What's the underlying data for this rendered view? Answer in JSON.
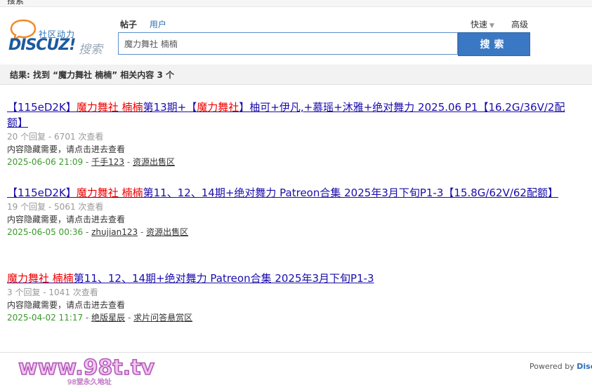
{
  "topbar": {
    "text": "搜索"
  },
  "logo": {
    "cn_text": "社区动力",
    "en_text": "DISCUZ!",
    "search_text": "搜索"
  },
  "tabs": [
    {
      "label": "帖子",
      "active": true
    },
    {
      "label": "用户",
      "active": false
    }
  ],
  "quick_label": "快速",
  "advanced_label": "高级",
  "search": {
    "value": "魔力舞社 楠楠",
    "button_label": "搜索"
  },
  "result_summary": "结果: 找到 “魔力舞社 楠楠” 相关内容 3 个",
  "results": [
    {
      "title_parts": [
        {
          "text": "【115eD2K】",
          "hl": false
        },
        {
          "text": "魔力舞社 楠楠",
          "hl": true
        },
        {
          "text": "第13期+【",
          "hl": false
        },
        {
          "text": "魔力舞社",
          "hl": true
        },
        {
          "text": "】柚可+伊凡,+慕瑶+沐雅+绝对舞力 2025.06 P1【16.2G/36V/2配额】",
          "hl": false
        }
      ],
      "meta": "20 个回复 - 6701 次查看",
      "desc": "内容隐藏需要，请点击进去查看",
      "date": "2025-06-06 21:09",
      "author": "千手123",
      "forum": "资源出售区"
    },
    {
      "title_parts": [
        {
          "text": "【115eD2K】",
          "hl": false
        },
        {
          "text": "魔力舞社 楠楠",
          "hl": true
        },
        {
          "text": "第11、12、14期+绝对舞力 Patreon合集 2025年3月下旬P1-3【15.8G/62V/62配额】",
          "hl": false
        }
      ],
      "meta": "19 个回复 - 5061 次查看",
      "desc": "内容隐藏需要，请点击进去查看",
      "date": "2025-06-05 00:36",
      "author": "zhujian123",
      "forum": "资源出售区"
    },
    {
      "title_parts": [
        {
          "text": "魔力舞社 楠楠",
          "hl": true
        },
        {
          "text": "第11、12、14期+绝对舞力 Patreon合集 2025年3月下旬P1-3",
          "hl": false
        }
      ],
      "meta": "3 个回复 - 1041 次查看",
      "desc": "内容隐藏需要，请点击进去查看",
      "date": "2025-04-02 11:17",
      "author": "绝版星辰",
      "forum": "求片问答悬赏区"
    }
  ],
  "watermark": {
    "main": "www.98t.tv",
    "sub": "98堂永久地址"
  },
  "powered_by": {
    "prefix": "Powered by ",
    "brand": "Discuz!"
  },
  "colors": {
    "accent": "#3a78c3",
    "highlight": "#ee0000",
    "link": "#1a0dab",
    "date": "#3a9a2a"
  }
}
